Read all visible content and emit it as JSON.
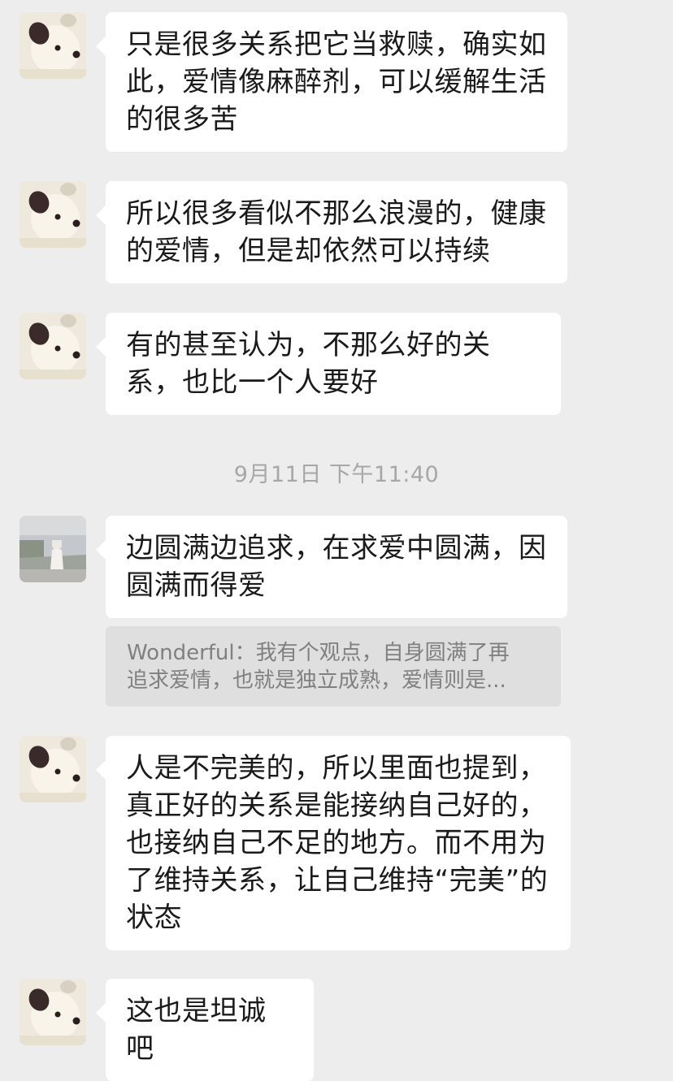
{
  "messages": [
    {
      "sender": "bear",
      "text": "只是很多关系把它当救赎，确实如此，爱情像麻醉剂，可以缓解生活的很多苦"
    },
    {
      "sender": "bear",
      "text": "所以很多看似不那么浪漫的，健康的爱情，但是却依然可以持续"
    },
    {
      "sender": "bear",
      "text": "有的甚至认为，不那么好的关系，也比一个人要好"
    },
    {
      "sender": "photo",
      "text": "边圆满边追求，在求爱中圆满，因圆满而得爱"
    },
    {
      "sender": "bear",
      "text": "人是不完美的，所以里面也提到，真正好的关系是能接纳自己好的，也接纳自己不足的地方。而不用为了维持关系，让自己维持“完美”的状态"
    },
    {
      "sender": "bear",
      "text": "这也是坦诚吧"
    }
  ],
  "timestamp": "9月11日 下午11:40",
  "quote": {
    "line1": "Wonderful：我有个观点，自身圆满了再",
    "line2": "追求爱情，也就是独立成熟，爱情则是..."
  },
  "colors": {
    "background": "#ededed",
    "bubble": "#ffffff",
    "quote_bg": "#dfdfdf",
    "timestamp": "#a7a7a7"
  }
}
